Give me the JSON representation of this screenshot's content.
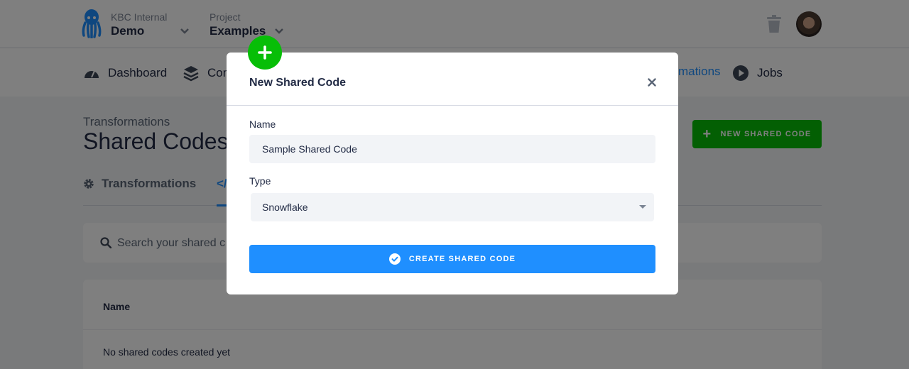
{
  "header": {
    "organization_label": "KBC Internal",
    "organization_value": "Demo",
    "project_label": "Project",
    "project_value": "Examples"
  },
  "nav": {
    "items": [
      {
        "label": "Dashboard",
        "icon": "dashboard-icon"
      },
      {
        "label": "Com",
        "icon": "layers-icon"
      },
      {
        "label": "mations",
        "icon": "",
        "active": true
      },
      {
        "label": "Jobs",
        "icon": "play-icon"
      }
    ]
  },
  "page": {
    "breadcrumb": "Transformations",
    "title": "Shared Codes",
    "new_button_label": "NEW SHARED CODE",
    "tabs": [
      {
        "label": "Transformations",
        "icon": "gear-icon"
      },
      {
        "label": "</",
        "active": true
      }
    ],
    "search_placeholder": "Search your shared c",
    "table": {
      "column_name": "Name",
      "empty_text": "No shared codes created yet"
    }
  },
  "modal": {
    "title": "New Shared Code",
    "name_label": "Name",
    "name_value": "Sample Shared Code",
    "type_label": "Type",
    "type_value": "Snowflake",
    "submit_label": "CREATE SHARED CODE"
  },
  "colors": {
    "primary": "#1f8fff",
    "success": "#07be07",
    "text": "#222b45",
    "muted": "#7c8594"
  }
}
